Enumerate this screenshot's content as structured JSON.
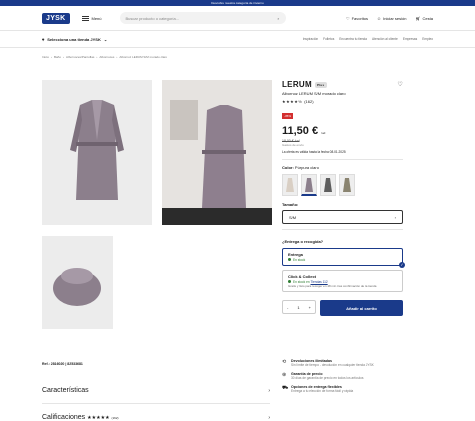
{
  "top_banner": "Descubre nuestra categoría de invierno",
  "header": {
    "logo": "JYSK",
    "menu_label": "Menú",
    "search_placeholder": "Buscar producto o categoría...",
    "favorites": "Favoritos",
    "login": "Iniciar sesión",
    "cart": "Cesta"
  },
  "store_bar": {
    "select_store": "Selecciona una tienda JYSK",
    "links": [
      "Inspiración",
      "Folletos",
      "Encuentra tu tienda",
      "Atención al cliente",
      "Empresas",
      "Empleo"
    ]
  },
  "breadcrumb": [
    "Inicio",
    "Baño",
    "Albornoces/Pantuflas",
    "Albornoces",
    "Albornoz LERUM S/M morado claro"
  ],
  "product": {
    "name": "LERUM",
    "tag": "Plus",
    "subtitle": "Albornoz LERUM S/M morado claro",
    "stars": "★★★★½",
    "reviews": "(162)",
    "discount": "-35%",
    "price": "11,50 €",
    "price_unit": "/ud",
    "old_price": "18,00 € /ud",
    "shipping": "Gastos de envío",
    "offer_note": "La oferta es válida hasta la fecha 08.01.2025",
    "color_label": "Color:",
    "color_value": "Púrpura claro",
    "size_label": "Tamaño:",
    "size_value": "S/M",
    "delivery_question": "¿Entrega o recogida?",
    "delivery": {
      "title": "Entrega",
      "status": "En stock"
    },
    "click_collect": {
      "title": "Click & Collect",
      "status": "En stock en",
      "store_link": "Tiendas 112",
      "desc": "Gratis y listo para recoger en 48 min tras confirmación de la tienda"
    },
    "qty_minus": "-",
    "qty": "1",
    "qty_plus": "+",
    "add_to_cart": "Añadir al carrito",
    "ref": "Ref.: 2816020 | 82533681"
  },
  "benefits": [
    {
      "icon": "return-icon",
      "title": "Devoluciones ilimitadas",
      "desc": "Sin límite de tiempo - devolución en cualquier tienda JYSK"
    },
    {
      "icon": "price-guarantee-icon",
      "title": "Garantía de precio",
      "desc": "30 días de garantía de precio en todos los artículos"
    },
    {
      "icon": "truck-icon",
      "title": "Opciones de entrega flexibles",
      "desc": "Entrega a tu elección de forma fácil y rápida"
    }
  ],
  "accordion": {
    "features": "Características",
    "ratings": "Calificaciones",
    "ratings_stars": "★★★★★",
    "ratings_count": "(162)"
  },
  "colors": {
    "brand": "#1a3a8a",
    "sale": "#d32f2f",
    "stock": "#2e7d32"
  }
}
